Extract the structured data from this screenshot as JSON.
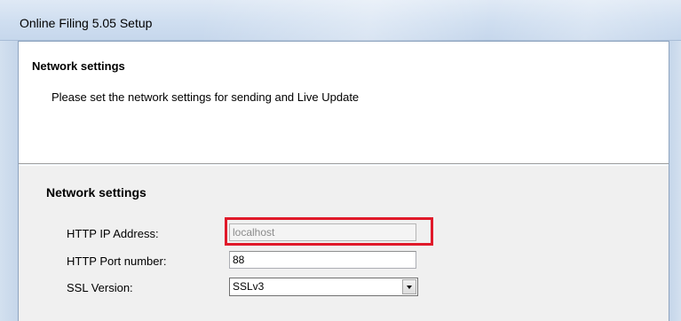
{
  "window": {
    "title": "Online Filing 5.05 Setup"
  },
  "header": {
    "title": "Network settings",
    "description": "Please set the network settings for sending and Live Update"
  },
  "network_group": {
    "title": "Network settings",
    "fields": [
      {
        "label": "HTTP IP Address:",
        "value": "localhost",
        "disabled": true,
        "highlighted": true
      },
      {
        "label": "HTTP Port number:",
        "value": "88"
      },
      {
        "label": "SSL Version:",
        "value": "SSLv3",
        "type": "dropdown"
      }
    ]
  },
  "colors": {
    "highlight_border": "#e0192a",
    "header_background": "#ffffff",
    "body_background": "#f0f0f0"
  },
  "icons": {
    "dropdown_arrow": "chevron-down-icon"
  }
}
